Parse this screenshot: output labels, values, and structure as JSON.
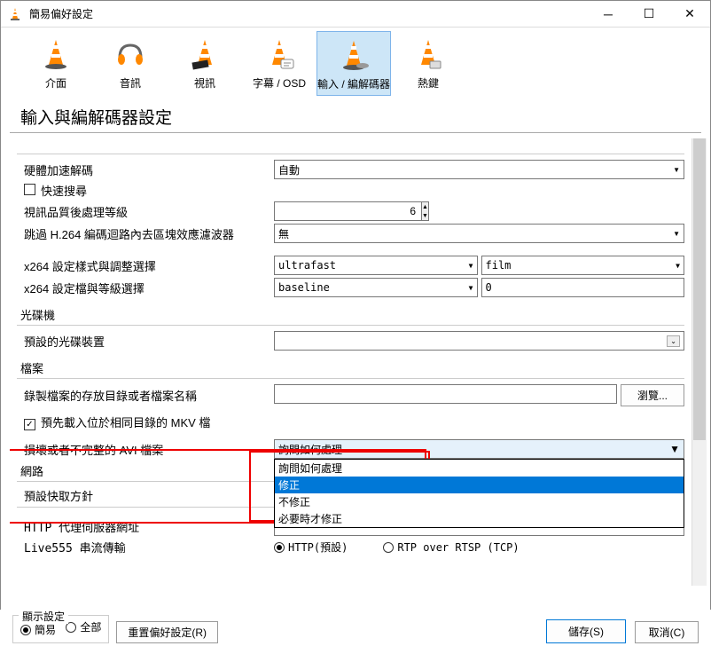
{
  "window": {
    "title": "簡易偏好設定"
  },
  "toolbar": {
    "items": [
      {
        "label": "介面"
      },
      {
        "label": "音訊"
      },
      {
        "label": "視訊"
      },
      {
        "label": "字幕 / OSD"
      },
      {
        "label": "輸入 / 編解碼器"
      },
      {
        "label": "熱鍵"
      }
    ]
  },
  "header": "輸入與編解碼器設定",
  "fields": {
    "hw_decode_label": "硬體加速解碼",
    "hw_decode_value": "自動",
    "fast_search_label": "快速搜尋",
    "video_quality_label": "視訊品質後處理等級",
    "video_quality_value": "6",
    "skip_h264_label": "跳過 H.264 編碼迴路內去區塊效應濾波器",
    "skip_h264_value": "無",
    "x264_style_label": "x264 設定樣式與調整選擇",
    "x264_style_value": "ultrafast",
    "x264_tune_value": "film",
    "x264_profile_label": "x264 設定檔與等級選擇",
    "x264_profile_value": "baseline",
    "x264_level_value": "0"
  },
  "sections": {
    "disc": "光碟機",
    "disc_default_label": "預設的光碟裝置",
    "file": "檔案",
    "record_path_label": "錄製檔案的存放目錄或者檔案名稱",
    "browse_btn": "瀏覽...",
    "preload_mkv_label": "預先載入位於相同目錄的 MKV 檔",
    "avi_label": "損壞或者不完整的 AVI 檔案",
    "network": "網路",
    "cache_policy": "預設快取方針",
    "http_proxy": "HTTP 代理伺服器網址",
    "live555": "Live555 串流傳輸",
    "radio_http": "HTTP(預設)",
    "radio_rtp": "RTP over RTSP (TCP)"
  },
  "dropdown": {
    "selected": "詢問如何處理",
    "options": [
      "詢問如何處理",
      "修正",
      "不修正",
      "必要時才修正"
    ]
  },
  "footer": {
    "show_settings": "顯示設定",
    "simple": "簡易",
    "all": "全部",
    "reset": "重置偏好設定(R)",
    "save": "儲存(S)",
    "cancel": "取消(C)"
  }
}
